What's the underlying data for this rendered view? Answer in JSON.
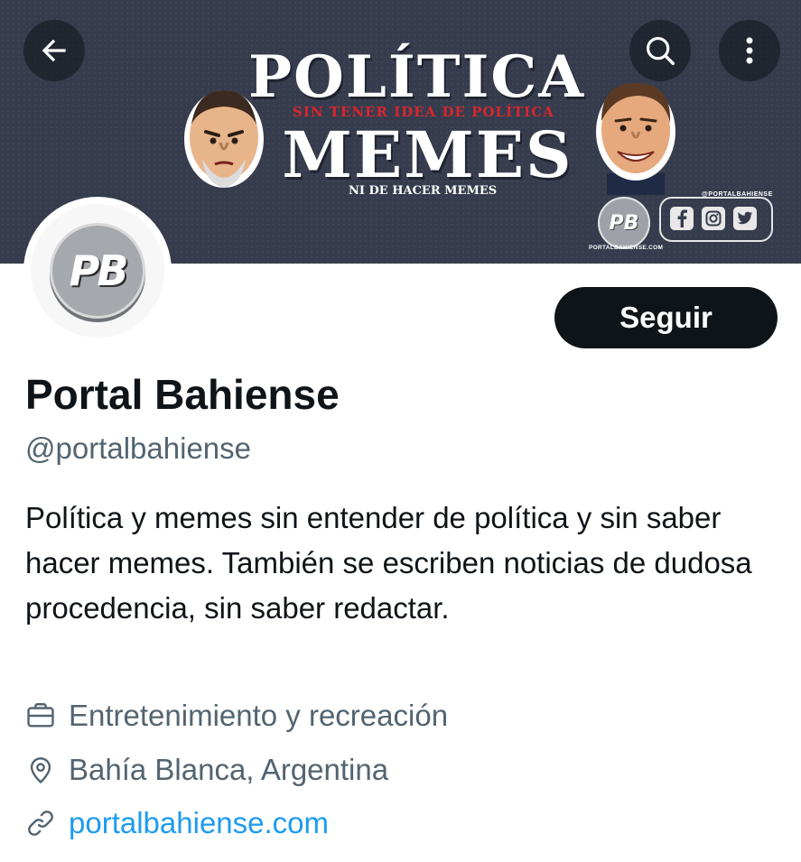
{
  "nav": {
    "back_icon": "arrow-left-icon",
    "search_icon": "search-icon",
    "more_icon": "more-vertical-icon"
  },
  "banner": {
    "title_line1": "POLÍTICA",
    "title_line2": "MEMES",
    "subtitle_top": "SIN TENER IDEA DE POLÍTICA",
    "subtitle_bottom": "NI DE HACER MEMES",
    "logo_text": "PB",
    "handle": "@PORTALBAHIENSE",
    "url": "PORTALBAHIENSE.COM",
    "social_icons": [
      "facebook-icon",
      "instagram-icon",
      "twitter-icon"
    ],
    "colors": {
      "background": "#363c4d",
      "subtitle": "#d8262e"
    }
  },
  "profile": {
    "avatar_text": "PB",
    "follow_label": "Seguir",
    "name": "Portal Bahiense",
    "handle": "@portalbahiense",
    "bio": "Política y memes sin entender de política y sin saber hacer memes. También se escriben noticias de dudosa procedencia, sin saber redactar.",
    "category": "Entretenimiento y recreación",
    "location": "Bahía Blanca, Argentina",
    "website": "portalbahiense.com"
  },
  "colors": {
    "text_primary": "#0f1419",
    "text_secondary": "#536471",
    "link": "#1d9bf0",
    "button_bg": "#0f1419"
  }
}
